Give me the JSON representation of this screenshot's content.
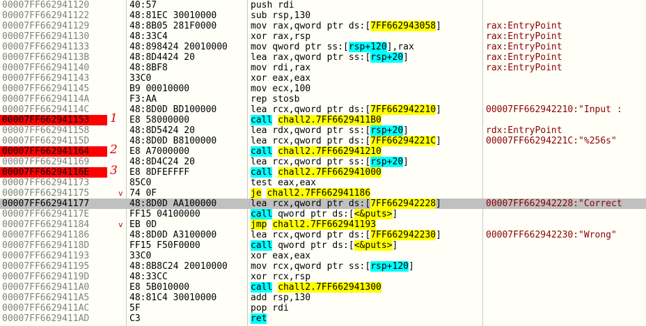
{
  "rows": [
    {
      "addr": "00007FF662941120",
      "bytes": "40:57",
      "instr": [
        {
          "t": "push rdi"
        }
      ],
      "comment": ""
    },
    {
      "addr": "00007FF662941122",
      "bytes": "48:81EC 30010000",
      "instr": [
        {
          "t": "sub rsp,130"
        }
      ],
      "comment": ""
    },
    {
      "addr": "00007FF662941129",
      "bytes": "48:8B05 281F0000",
      "instr": [
        {
          "t": "mov rax,qword ptr ds:["
        },
        {
          "t": "7FF662943058",
          "h": "y"
        },
        {
          "t": "]"
        }
      ],
      "comment": "rax:EntryPoint"
    },
    {
      "addr": "00007FF662941130",
      "bytes": "48:33C4",
      "instr": [
        {
          "t": "xor rax,rsp"
        }
      ],
      "comment": "rax:EntryPoint"
    },
    {
      "addr": "00007FF662941133",
      "bytes": "48:898424 20010000",
      "instr": [
        {
          "t": "mov qword ptr ss:["
        },
        {
          "t": "rsp+120",
          "h": "c"
        },
        {
          "t": "],rax"
        }
      ],
      "comment": "rax:EntryPoint"
    },
    {
      "addr": "00007FF66294113B",
      "bytes": "48:8D4424 20",
      "instr": [
        {
          "t": "lea rax,qword ptr ss:["
        },
        {
          "t": "rsp+20",
          "h": "c"
        },
        {
          "t": "]"
        }
      ],
      "comment": "rax:EntryPoint"
    },
    {
      "addr": "00007FF662941140",
      "bytes": "48:8BF8",
      "instr": [
        {
          "t": "mov rdi,rax"
        }
      ],
      "comment": "rax:EntryPoint"
    },
    {
      "addr": "00007FF662941143",
      "bytes": "33C0",
      "instr": [
        {
          "t": "xor eax,eax"
        }
      ],
      "comment": ""
    },
    {
      "addr": "00007FF662941145",
      "bytes": "B9 00010000",
      "instr": [
        {
          "t": "mov ecx,100"
        }
      ],
      "comment": ""
    },
    {
      "addr": "00007FF66294114A",
      "bytes": "F3:AA",
      "instr": [
        {
          "t": "rep stosb"
        }
      ],
      "comment": ""
    },
    {
      "addr": "00007FF66294114C",
      "bytes": "48:8D0D BD100000",
      "instr": [
        {
          "t": "lea rcx,qword ptr ds:["
        },
        {
          "t": "7FF662942210",
          "h": "y"
        },
        {
          "t": "]"
        }
      ],
      "comment": "00007FF662942210:\"Input : "
    },
    {
      "addr": "00007FF662941153",
      "bp": true,
      "mark": "1",
      "bytes": "E8 58000000",
      "instr": [
        {
          "t": "call",
          "h": "c"
        },
        {
          "t": " "
        },
        {
          "t": "chall2.7FF6629411B0",
          "h": "y"
        }
      ],
      "comment": ""
    },
    {
      "addr": "00007FF662941158",
      "bytes": "48:8D5424 20",
      "instr": [
        {
          "t": "lea rdx,qword ptr ss:["
        },
        {
          "t": "rsp+20",
          "h": "c"
        },
        {
          "t": "]"
        }
      ],
      "comment": "rdx:EntryPoint"
    },
    {
      "addr": "00007FF66294115D",
      "bytes": "48:8D0D B8100000",
      "instr": [
        {
          "t": "lea rcx,qword ptr ds:["
        },
        {
          "t": "7FF66294221C",
          "h": "y"
        },
        {
          "t": "]"
        }
      ],
      "comment": "00007FF66294221C:\"%256s\""
    },
    {
      "addr": "00007FF662941164",
      "bp": true,
      "mark": "2",
      "bytes": "E8 A7000000",
      "instr": [
        {
          "t": "call",
          "h": "c"
        },
        {
          "t": " "
        },
        {
          "t": "chall2.7FF662941210",
          "h": "y"
        }
      ],
      "comment": ""
    },
    {
      "addr": "00007FF662941169",
      "bytes": "48:8D4C24 20",
      "instr": [
        {
          "t": "lea rcx,qword ptr ss:["
        },
        {
          "t": "rsp+20",
          "h": "c"
        },
        {
          "t": "]"
        }
      ],
      "comment": ""
    },
    {
      "addr": "00007FF66294116E",
      "bp": true,
      "mark": "3",
      "bytes": "E8 8DFEFFFF",
      "instr": [
        {
          "t": "call",
          "h": "c"
        },
        {
          "t": " "
        },
        {
          "t": "chall2.7FF662941000",
          "h": "y"
        }
      ],
      "comment": ""
    },
    {
      "addr": "00007FF662941173",
      "bytes": "85C0",
      "instr": [
        {
          "t": "test eax,eax"
        }
      ],
      "comment": ""
    },
    {
      "addr": "00007FF662941175",
      "arrow": "v",
      "bytes": "74 0F",
      "instr": [
        {
          "t": "je",
          "h": "y"
        },
        {
          "t": " "
        },
        {
          "t": "chall2.7FF662941186",
          "h": "y"
        }
      ],
      "comment": ""
    },
    {
      "addr": "00007FF662941177",
      "sel": true,
      "bytes": "48:8D0D AA100000",
      "instr": [
        {
          "t": "lea rcx,qword ptr ds:["
        },
        {
          "t": "7FF662942228",
          "h": "y"
        },
        {
          "t": "]"
        }
      ],
      "comment": "00007FF662942228:\"Correct"
    },
    {
      "addr": "00007FF66294117E",
      "bytes": "FF15 04100000",
      "instr": [
        {
          "t": "call",
          "h": "c"
        },
        {
          "t": " qword ptr ds:["
        },
        {
          "t": "<&puts>",
          "h": "y"
        },
        {
          "t": "]"
        }
      ],
      "comment": ""
    },
    {
      "addr": "00007FF662941184",
      "arrow": "v",
      "bytes": "EB 0D",
      "instr": [
        {
          "t": "jmp",
          "h": "y"
        },
        {
          "t": " "
        },
        {
          "t": "chall2.7FF662941193",
          "h": "y"
        }
      ],
      "comment": ""
    },
    {
      "addr": "00007FF662941186",
      "bytes": "48:8D0D A3100000",
      "instr": [
        {
          "t": "lea rcx,qword ptr ds:["
        },
        {
          "t": "7FF662942230",
          "h": "y"
        },
        {
          "t": "]"
        }
      ],
      "comment": "00007FF662942230:\"Wrong\""
    },
    {
      "addr": "00007FF66294118D",
      "bytes": "FF15 F50F0000",
      "instr": [
        {
          "t": "call",
          "h": "c"
        },
        {
          "t": " qword ptr ds:["
        },
        {
          "t": "<&puts>",
          "h": "y"
        },
        {
          "t": "]"
        }
      ],
      "comment": ""
    },
    {
      "addr": "00007FF662941193",
      "bytes": "33C0",
      "instr": [
        {
          "t": "xor eax,eax"
        }
      ],
      "comment": ""
    },
    {
      "addr": "00007FF662941195",
      "bytes": "48:8B8C24 20010000",
      "instr": [
        {
          "t": "mov rcx,qword ptr ss:["
        },
        {
          "t": "rsp+120",
          "h": "c"
        },
        {
          "t": "]"
        }
      ],
      "comment": ""
    },
    {
      "addr": "00007FF66294119D",
      "bytes": "48:33CC",
      "instr": [
        {
          "t": "xor rcx,rsp"
        }
      ],
      "comment": ""
    },
    {
      "addr": "00007FF6629411A0",
      "bytes": "E8 5B010000",
      "instr": [
        {
          "t": "call",
          "h": "c"
        },
        {
          "t": " "
        },
        {
          "t": "chall2.7FF662941300",
          "h": "y"
        }
      ],
      "comment": ""
    },
    {
      "addr": "00007FF6629411A5",
      "bytes": "48:81C4 30010000",
      "instr": [
        {
          "t": "add rsp,130"
        }
      ],
      "comment": ""
    },
    {
      "addr": "00007FF6629411AC",
      "bytes": "5F",
      "instr": [
        {
          "t": "pop rdi"
        }
      ],
      "comment": ""
    },
    {
      "addr": "00007FF6629411AD",
      "bytes": "C3",
      "instr": [
        {
          "t": "ret",
          "h": "c"
        }
      ],
      "comment": ""
    }
  ],
  "colors": {
    "breakpoint": "#ff0000",
    "selected": "#c0c0c0",
    "highlight_yellow": "#ffff00",
    "highlight_cyan": "#00ffff",
    "comment": "#8b0000"
  }
}
